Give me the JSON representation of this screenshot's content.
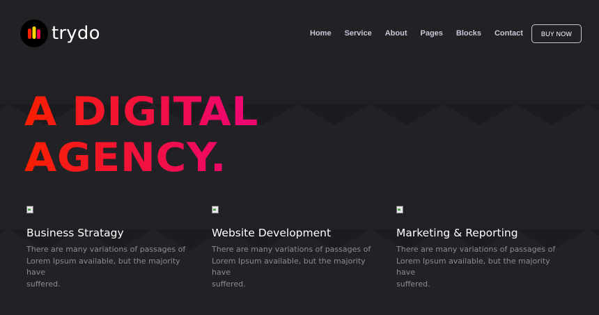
{
  "brand": {
    "name": "trydo",
    "mark_colors": [
      "#f9004d",
      "#ffd700",
      "#f81f01"
    ]
  },
  "nav": {
    "items": [
      {
        "label": "Home"
      },
      {
        "label": "Service"
      },
      {
        "label": "About"
      },
      {
        "label": "Pages"
      },
      {
        "label": "Blocks"
      },
      {
        "label": "Contact"
      }
    ],
    "cta_label": "BUY NOW"
  },
  "hero": {
    "line1": "A DIGITAL",
    "line2": "AGENCY.",
    "gradient_from": "#f81f01",
    "gradient_to": "#ee076e"
  },
  "services": [
    {
      "title": "Business Stratagy",
      "desc_line1": "There are many variations of passages of",
      "desc_line2": "Lorem Ipsum available, but the majority have",
      "desc_line3": "suffered."
    },
    {
      "title": "Website Development",
      "desc_line1": "There are many variations of passages of",
      "desc_line2": "Lorem Ipsum available, but the majority have",
      "desc_line3": "suffered."
    },
    {
      "title": "Marketing & Reporting",
      "desc_line1": "There are many variations of passages of",
      "desc_line2": "Lorem Ipsum available, but the majority have",
      "desc_line3": "suffered."
    }
  ],
  "colors": {
    "background": "#1c1b1f",
    "nav_text": "#c6c9d8",
    "body_text": "#8a8b99"
  }
}
